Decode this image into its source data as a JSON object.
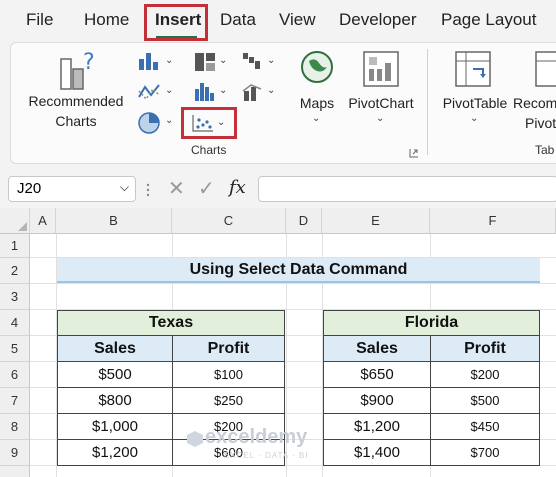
{
  "ribbon_tabs": [
    "File",
    "Home",
    "Insert",
    "Data",
    "View",
    "Developer",
    "Page Layout"
  ],
  "active_tab": "Insert",
  "ribbon": {
    "recommended_charts": [
      "Recommended",
      "Charts"
    ],
    "maps": "Maps",
    "pivotchart": "PivotChart",
    "pivottable": "PivotTable",
    "recommended_cut": [
      "Recom",
      "Pivot"
    ],
    "group_charts": "Charts",
    "group_tables_cut": "Tab"
  },
  "formula_bar": {
    "name_box": "J20",
    "fx": "fx",
    "formula": ""
  },
  "columns": [
    "A",
    "B",
    "C",
    "D",
    "E",
    "F"
  ],
  "rows": [
    "1",
    "2",
    "3",
    "4",
    "5",
    "6",
    "7",
    "8",
    "9"
  ],
  "sheet": {
    "title": "Using Select Data Command",
    "texas": {
      "header": "Texas",
      "cols": [
        "Sales",
        "Profit"
      ],
      "rows": [
        [
          "$500",
          "$100"
        ],
        [
          "$800",
          "$250"
        ],
        [
          "$1,000",
          "$200"
        ],
        [
          "$1,200",
          "$600"
        ]
      ]
    },
    "florida": {
      "header": "Florida",
      "cols": [
        "Sales",
        "Profit"
      ],
      "rows": [
        [
          "$650",
          "$200"
        ],
        [
          "$900",
          "$500"
        ],
        [
          "$1,200",
          "$450"
        ],
        [
          "$1,400",
          "$700"
        ]
      ]
    }
  },
  "watermark": {
    "name": "exceldemy",
    "tagline": "EXCEL · DATA · BI"
  },
  "colors": {
    "accent": "#217346",
    "highlight": "#c4303a",
    "table_header_green": "#e2efda",
    "table_header_blue": "#ddebf7"
  }
}
